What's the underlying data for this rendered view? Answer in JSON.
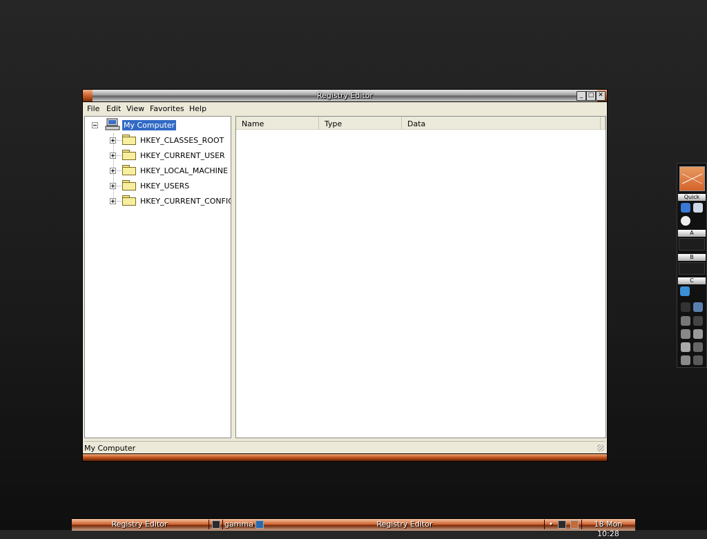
{
  "window": {
    "title": "Registry Editor",
    "buttons": {
      "minimize": "_",
      "maximize": "□",
      "close": "✕",
      "menu": "^"
    }
  },
  "menubar": {
    "items": [
      "File",
      "Edit",
      "View",
      "Favorites",
      "Help"
    ]
  },
  "tree": {
    "root": "My Computer",
    "keys": [
      "HKEY_CLASSES_ROOT",
      "HKEY_CURRENT_USER",
      "HKEY_LOCAL_MACHINE",
      "HKEY_USERS",
      "HKEY_CURRENT_CONFIG"
    ]
  },
  "list": {
    "columns": [
      "Name",
      "Type",
      "Data"
    ]
  },
  "statusbar": {
    "path": "My Computer"
  },
  "dock": {
    "quick_label": "Quick",
    "drive_labels": [
      "A",
      "B",
      "C"
    ]
  },
  "taskbar": {
    "left_task": "Registry Editor",
    "workspace": "gamma",
    "center_task": "Registry Editor",
    "clock": "18 Mon 10:28"
  },
  "colors": {
    "accent": "#d4632a",
    "selection": "#316ac5",
    "window_bg": "#ece9d8"
  }
}
